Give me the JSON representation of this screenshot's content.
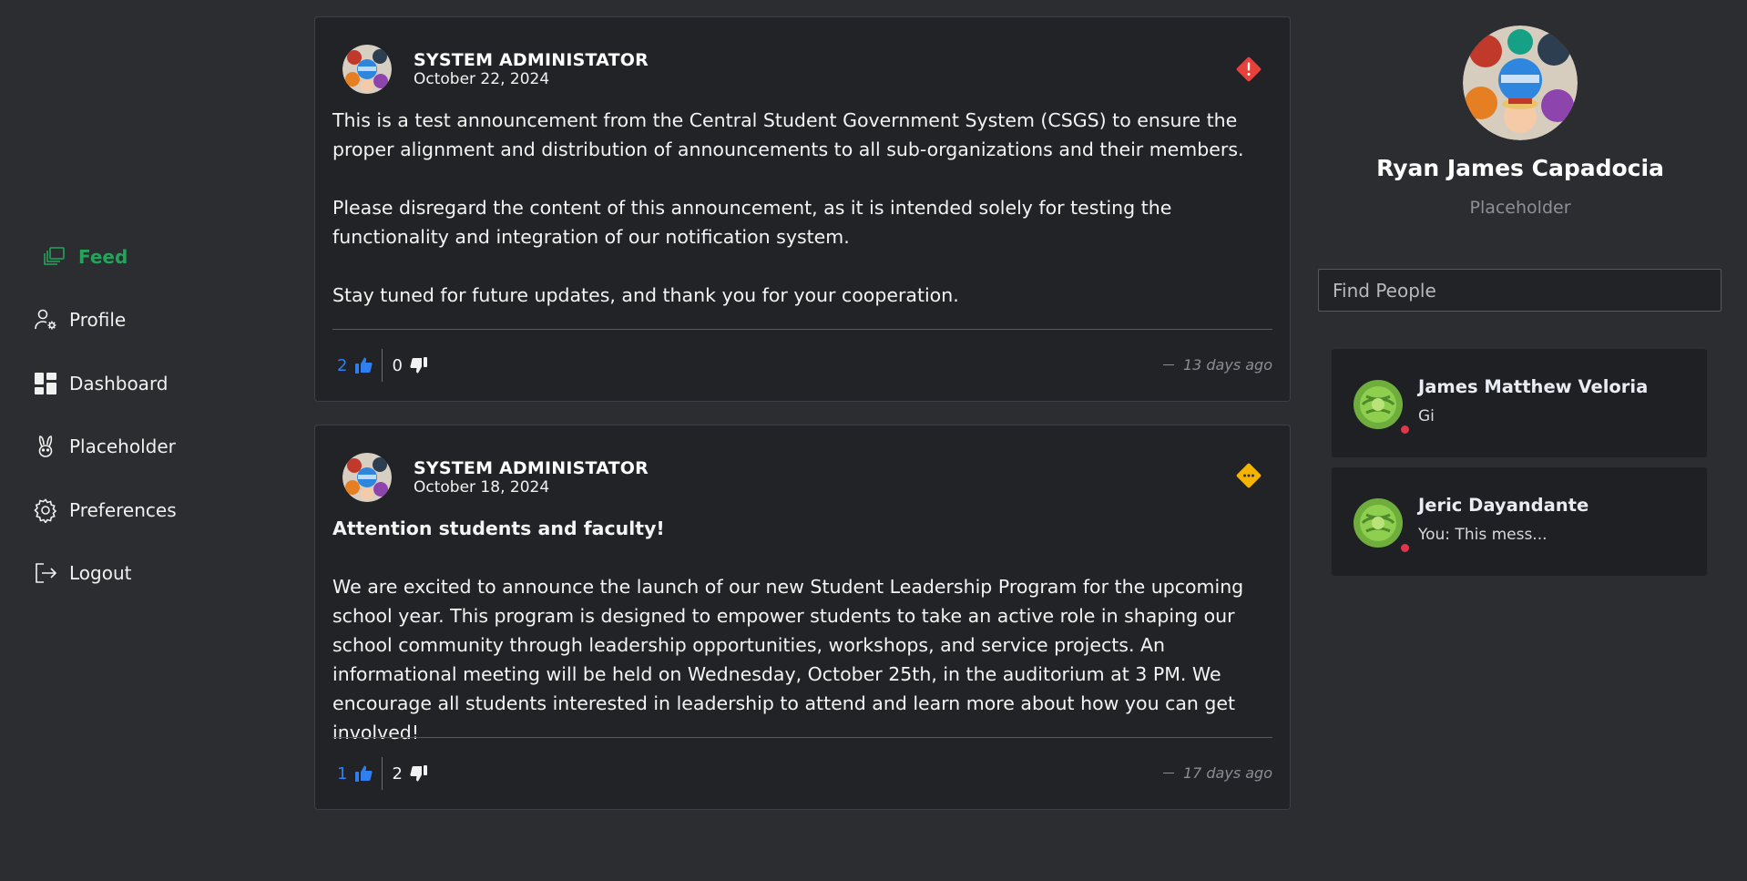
{
  "nav": {
    "items": [
      {
        "label": "Feed",
        "icon": "feed-icon",
        "active": true
      },
      {
        "label": "Profile",
        "icon": "user-settings-icon"
      },
      {
        "label": "Dashboard",
        "icon": "dashboard-icon"
      },
      {
        "label": "Placeholder",
        "icon": "bunny-icon"
      },
      {
        "label": "Preferences",
        "icon": "gear-icon"
      },
      {
        "label": "Logout",
        "icon": "logout-icon"
      }
    ],
    "active_color": "#24a35a"
  },
  "feed": {
    "posts": [
      {
        "author": "SYSTEM ADMINISTATOR",
        "date": "October 22, 2024",
        "priority_icon": "alert-diamond-icon",
        "priority_color": "#e8413b",
        "paragraphs": [
          "This is a test announcement from the Central Student Government System (CSGS) to ensure the proper alignment and distribution of announcements to all sub-organizations and their members.",
          "Please disregard the content of this announcement, as it is intended solely for testing the functionality and integration of our notification system.",
          "Stay tuned for future updates, and thank you for your cooperation."
        ],
        "likes": "2",
        "dislikes": "0",
        "ago": "13 days ago"
      },
      {
        "author": "SYSTEM ADMINISTATOR",
        "date": "October 18, 2024",
        "priority_icon": "ellipsis-diamond-icon",
        "priority_color": "#f5b400",
        "heading": "Attention students and faculty!",
        "paragraphs": [
          "We are excited to announce the launch of our new Student Leadership Program for the upcoming school year. This program is designed to empower students to take an active role in shaping our school community through leadership opportunities, workshops, and service projects. An informational meeting will be held on Wednesday, October 25th, in the auditorium at 3 PM. We encourage all students interested in leadership to attend and learn more about how you can get involved!"
        ],
        "likes": "1",
        "dislikes": "2",
        "ago": "17 days ago"
      }
    ],
    "like_color": "#2f7fef"
  },
  "profile": {
    "name": "Ryan James Capadocia",
    "role": "Placeholder"
  },
  "search": {
    "placeholder": "Find People"
  },
  "chats": [
    {
      "name": "James Matthew Veloria",
      "message": "Gi",
      "status": "offline",
      "status_color": "#e0354a"
    },
    {
      "name": "Jeric Dayandante",
      "message": "You: This mess...",
      "status": "offline",
      "status_color": "#e0354a"
    }
  ]
}
